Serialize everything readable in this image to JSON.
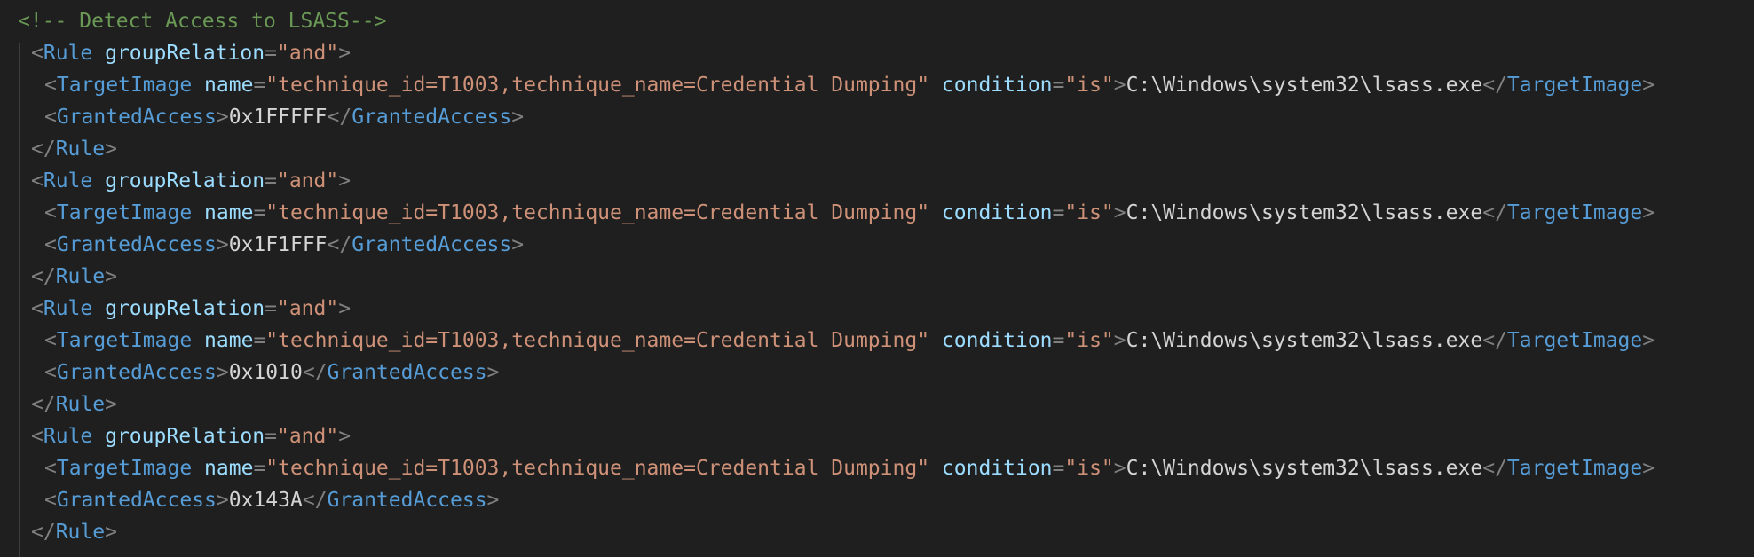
{
  "code": {
    "comment": "<!-- Detect Access to LSASS-->",
    "rules": [
      {
        "rule_tag": "Rule",
        "rule_attr": "groupRelation",
        "rule_value": "\"and\"",
        "target_tag": "TargetImage",
        "name_attr": "name",
        "name_value": "\"technique_id=T1003,technique_name=Credential Dumping\"",
        "cond_attr": "condition",
        "cond_value": "\"is\"",
        "target_text": "C:\\Windows\\system32\\lsass.exe",
        "access_tag": "GrantedAccess",
        "access_value": "0x1FFFFF"
      },
      {
        "rule_tag": "Rule",
        "rule_attr": "groupRelation",
        "rule_value": "\"and\"",
        "target_tag": "TargetImage",
        "name_attr": "name",
        "name_value": "\"technique_id=T1003,technique_name=Credential Dumping\"",
        "cond_attr": "condition",
        "cond_value": "\"is\"",
        "target_text": "C:\\Windows\\system32\\lsass.exe",
        "access_tag": "GrantedAccess",
        "access_value": "0x1F1FFF"
      },
      {
        "rule_tag": "Rule",
        "rule_attr": "groupRelation",
        "rule_value": "\"and\"",
        "target_tag": "TargetImage",
        "name_attr": "name",
        "name_value": "\"technique_id=T1003,technique_name=Credential Dumping\"",
        "cond_attr": "condition",
        "cond_value": "\"is\"",
        "target_text": "C:\\Windows\\system32\\lsass.exe",
        "access_tag": "GrantedAccess",
        "access_value": "0x1010"
      },
      {
        "rule_tag": "Rule",
        "rule_attr": "groupRelation",
        "rule_value": "\"and\"",
        "target_tag": "TargetImage",
        "name_attr": "name",
        "name_value": "\"technique_id=T1003,technique_name=Credential Dumping\"",
        "cond_attr": "condition",
        "cond_value": "\"is\"",
        "target_text": "C:\\Windows\\system32\\lsass.exe",
        "access_tag": "GrantedAccess",
        "access_value": "0x143A"
      }
    ]
  }
}
